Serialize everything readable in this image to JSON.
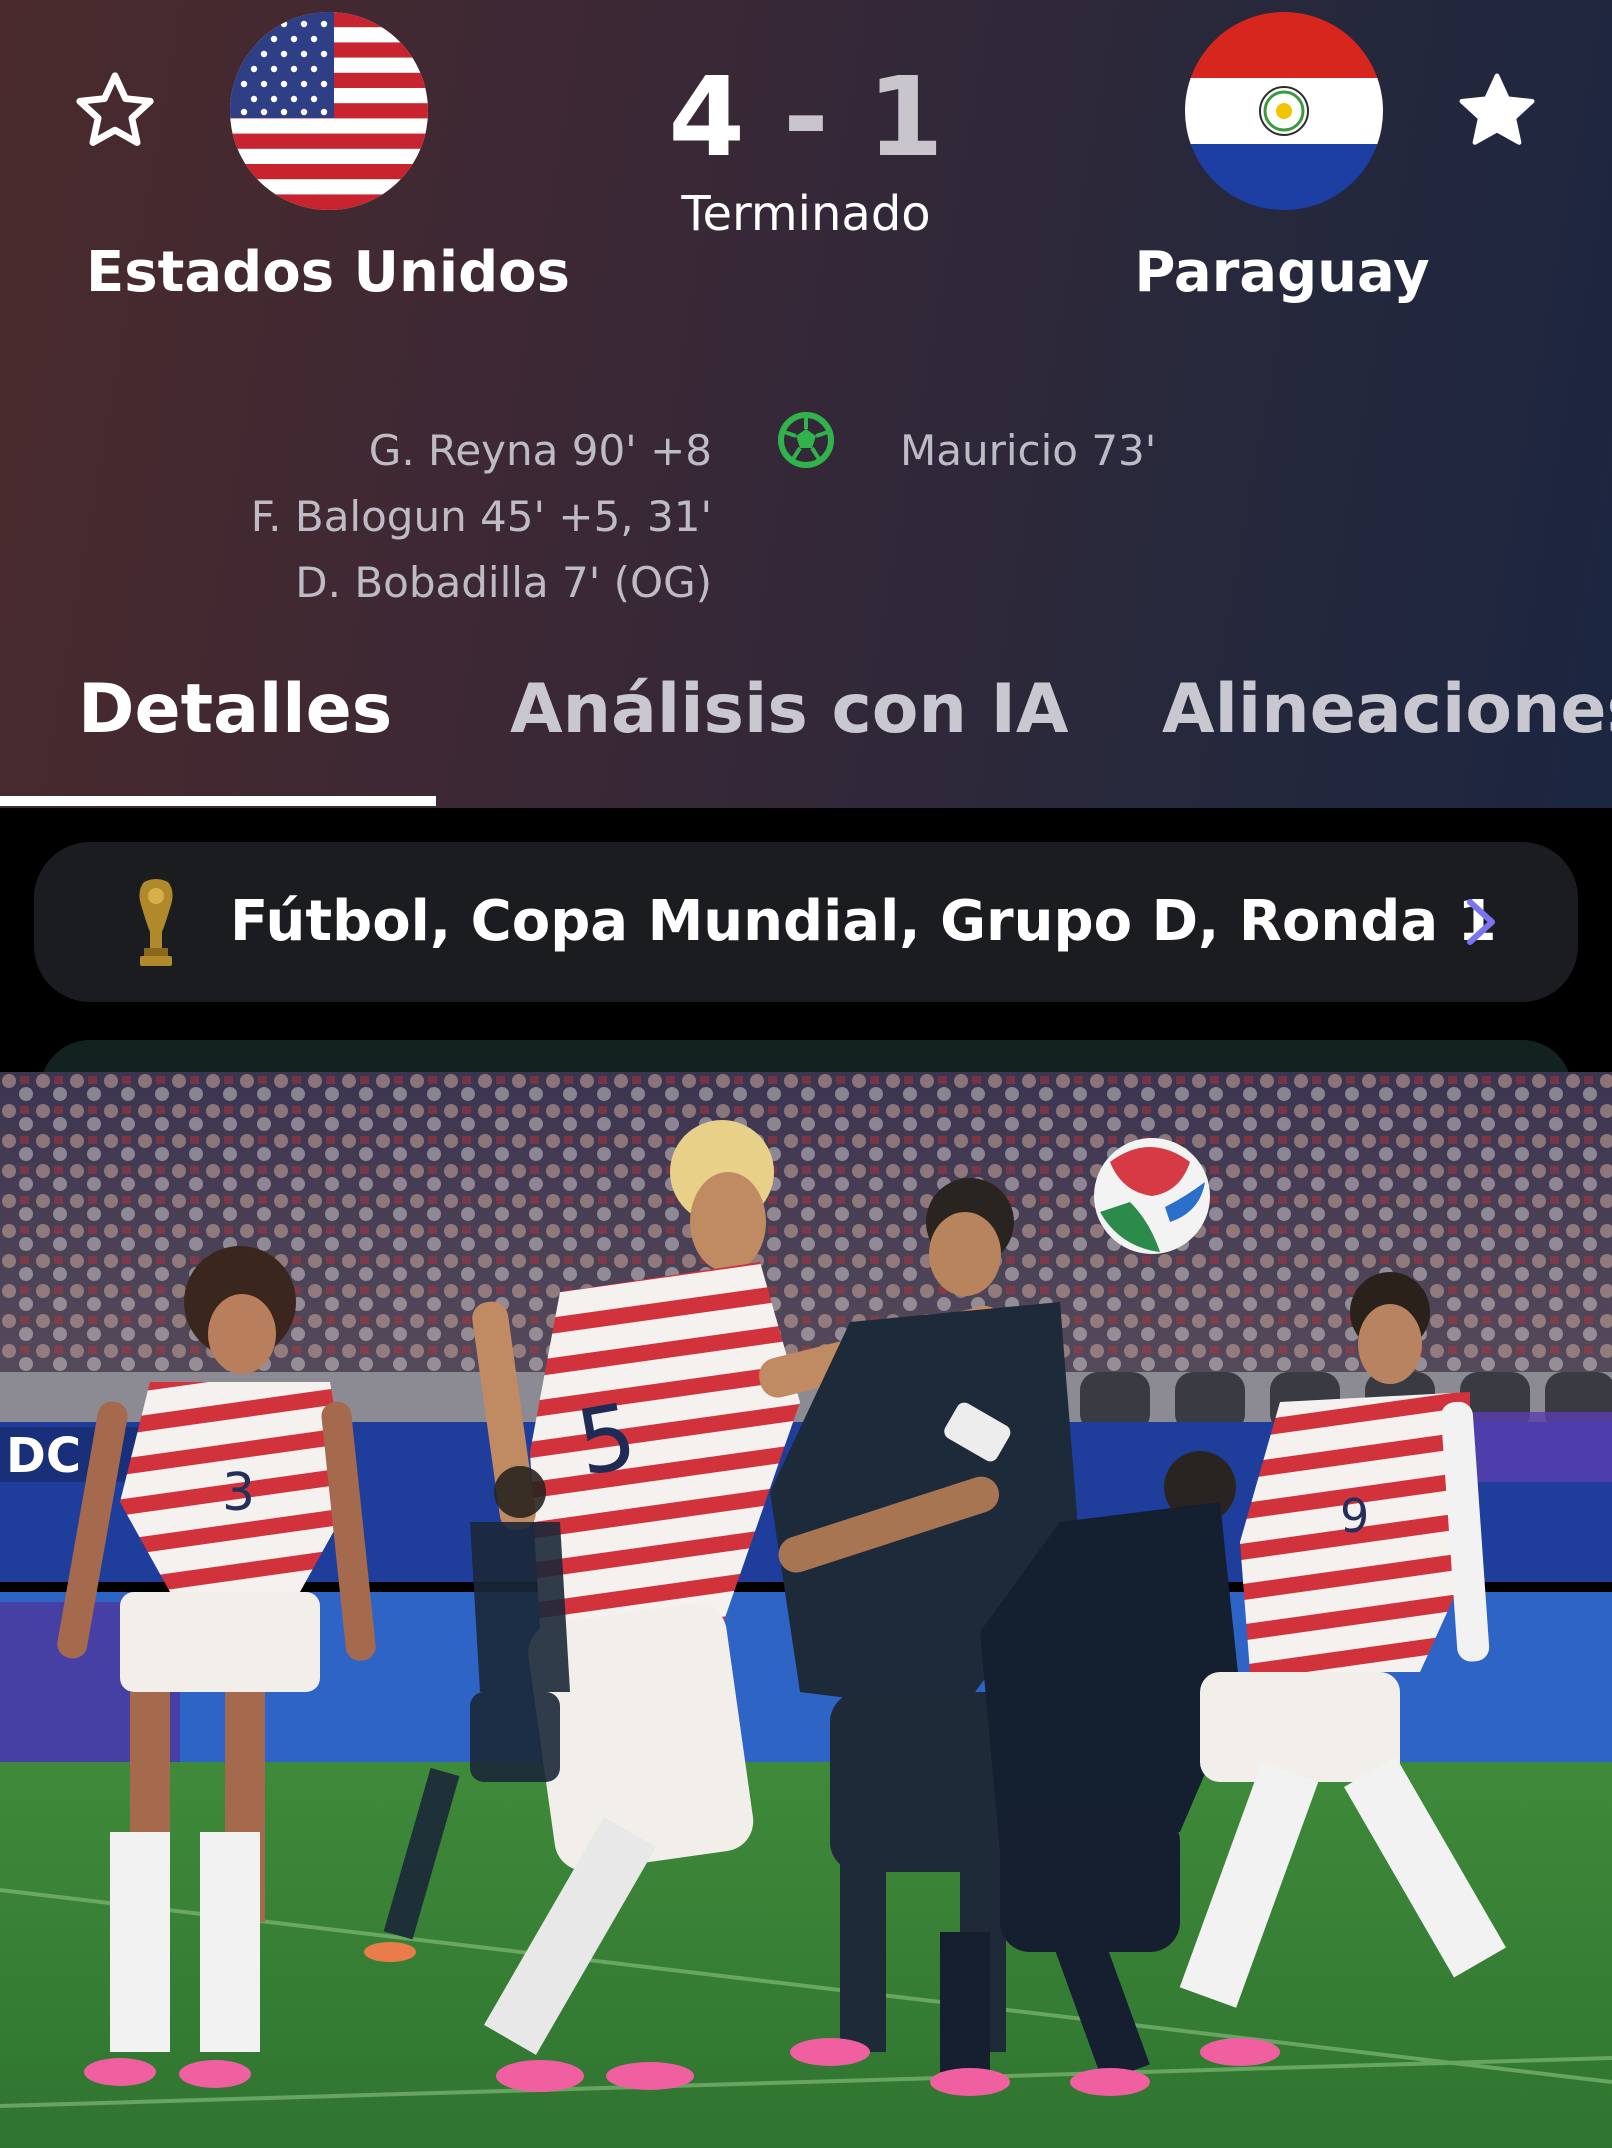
{
  "match": {
    "home": {
      "name": "Estados Unidos",
      "score": "4",
      "favorite": false,
      "scorers": [
        "G. Reyna 90' +8",
        "F. Balogun 45' +5, 31'",
        "D. Bobadilla 7' (OG)"
      ]
    },
    "away": {
      "name": "Paraguay",
      "score": "1",
      "favorite": true,
      "scorers": [
        "Mauricio 73'"
      ]
    },
    "separator": "-",
    "status": "Terminado"
  },
  "tabs": {
    "details": "Detalles",
    "ai_analysis": "Análisis con IA",
    "lineups": "Alineaciones",
    "active": "details"
  },
  "competition": {
    "label": "Fútbol, Copa Mundial, Grupo D, Ronda 1",
    "icon": "trophy-icon"
  },
  "icons": {
    "favorite": "star-icon",
    "goal": "soccer-ball-icon",
    "navigate": "chevron-right-icon"
  },
  "colors": {
    "goal_icon": "#2fb34a",
    "chevron": "#7b74f0",
    "trophy": "#b08a2a",
    "card_background": "#1b1c20"
  }
}
